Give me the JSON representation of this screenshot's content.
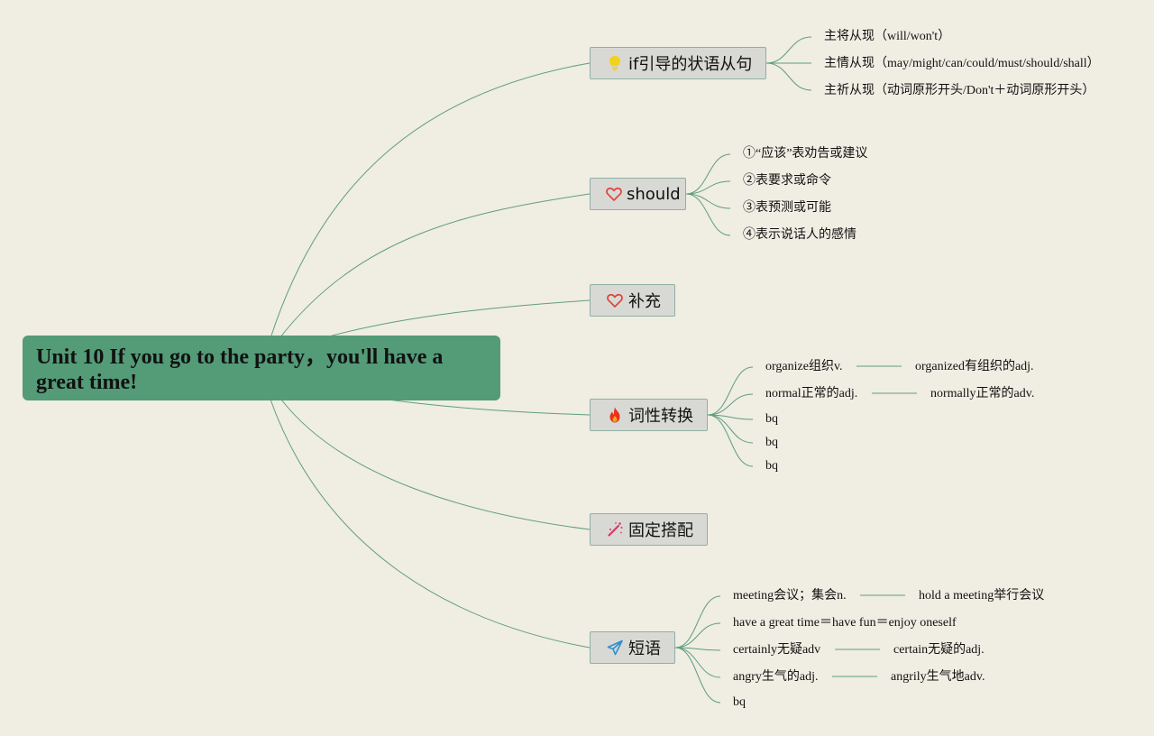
{
  "root": {
    "title": "Unit 10 If you go to the party，you'll have a great time!"
  },
  "topics": [
    {
      "id": "if",
      "label": "if引导的状语从句",
      "icon": "lightbulb-icon",
      "icon_color": "#f2d21b",
      "children": [
        {
          "text": "主将从现（will/won't）"
        },
        {
          "text": "主情从现（may/might/can/could/must/should/shall）"
        },
        {
          "text": "主祈从现（动词原形开头/Don't＋动词原形开头）"
        }
      ]
    },
    {
      "id": "should",
      "label": "should",
      "icon": "heart-icon",
      "icon_color": "#e0433a",
      "children": [
        {
          "text": "①“应该”表劝告或建议"
        },
        {
          "text": "②表要求或命令"
        },
        {
          "text": "③表预测或可能"
        },
        {
          "text": "④表示说话人的感情"
        }
      ]
    },
    {
      "id": "buchong",
      "label": "补充",
      "icon": "heart-icon",
      "icon_color": "#e0433a",
      "children": []
    },
    {
      "id": "cixing",
      "label": "词性转换",
      "icon": "fire-icon",
      "icon_color": "#e8321c",
      "children": [
        {
          "text": "organize组织v.",
          "pair": "organized有组织的adj."
        },
        {
          "text": "normal正常的adj.",
          "pair": "normally正常的adv."
        },
        {
          "text": "bq"
        },
        {
          "text": "bq"
        },
        {
          "text": "bq"
        }
      ]
    },
    {
      "id": "guding",
      "label": "固定搭配",
      "icon": "magic-wand-icon",
      "icon_color": "#e0336b",
      "children": []
    },
    {
      "id": "duanyu",
      "label": "短语",
      "icon": "paper-plane-icon",
      "icon_color": "#2f8fd0",
      "children": [
        {
          "text": "meeting会议；集会n.",
          "pair": "hold a meeting举行会议"
        },
        {
          "text": "have a great time＝have fun＝enjoy oneself"
        },
        {
          "text": "certainly无疑adv",
          "pair": "certain无疑的adj."
        },
        {
          "text": "angry生气的adj.",
          "pair": "angrily生气地adv."
        },
        {
          "text": "bq"
        }
      ]
    }
  ]
}
